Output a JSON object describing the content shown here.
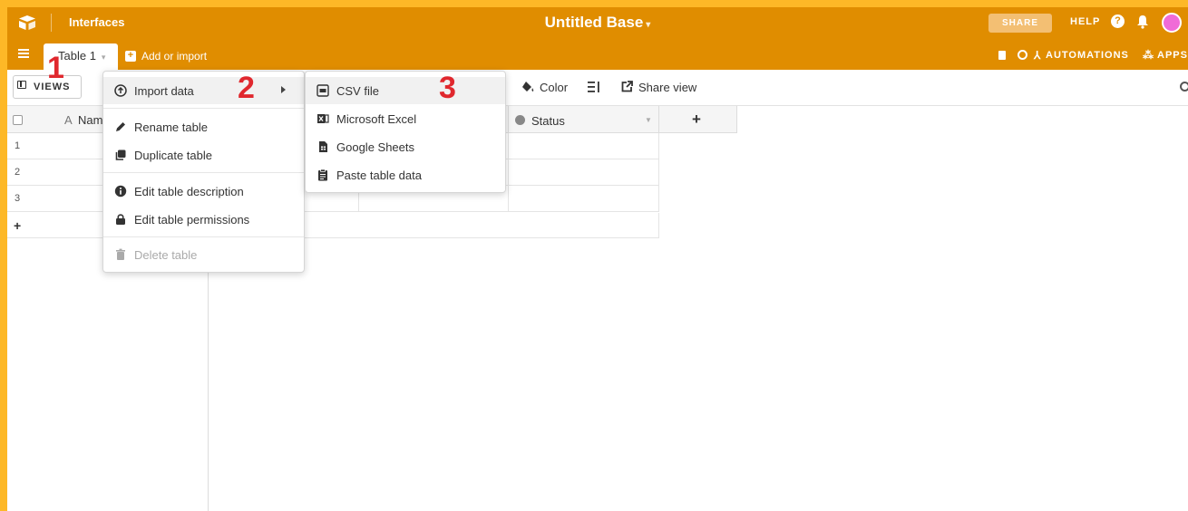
{
  "topbar": {
    "interfaces_label": "Interfaces",
    "base_title": "Untitled Base",
    "base_title_caret": "▾",
    "share_label": "SHARE",
    "help_label": "HELP",
    "help_icon_glyph": "?"
  },
  "tabbar": {
    "table_tab_label": "Table 1",
    "table_tab_caret": "▾",
    "add_import_label": "Add or import",
    "automations_label": "AUTOMATIONS",
    "apps_label": "APPS"
  },
  "toolbar": {
    "views_label": "VIEWS",
    "color_label": "Color",
    "share_view_label": "Share view"
  },
  "grid": {
    "name_column_icon": "A",
    "name_column_label": "Nam",
    "status_column_label": "Status",
    "rows": [
      "1",
      "2",
      "3"
    ],
    "add_row_glyph": "+",
    "add_column_glyph": "+"
  },
  "table_menu": {
    "items": [
      {
        "label": "Import data",
        "icon": "import-icon"
      },
      {
        "label": "Rename table",
        "icon": "pencil-icon"
      },
      {
        "label": "Duplicate table",
        "icon": "duplicate-icon"
      },
      {
        "label": "Edit table description",
        "icon": "info-icon"
      },
      {
        "label": "Edit table permissions",
        "icon": "lock-icon"
      },
      {
        "label": "Delete table",
        "icon": "trash-icon"
      }
    ]
  },
  "import_submenu": {
    "items": [
      {
        "label": "CSV file",
        "icon": "csv-file-icon"
      },
      {
        "label": "Microsoft Excel",
        "icon": "excel-icon"
      },
      {
        "label": "Google Sheets",
        "icon": "google-sheets-icon"
      },
      {
        "label": "Paste table data",
        "icon": "clipboard-icon"
      }
    ]
  },
  "annotations": {
    "step1": "1",
    "step2": "2",
    "step3": "3"
  },
  "colors": {
    "background_frame": "#fdb827",
    "topbar": "#e08d00",
    "annotation": "#e0282e",
    "avatar": "#f06bd7"
  }
}
